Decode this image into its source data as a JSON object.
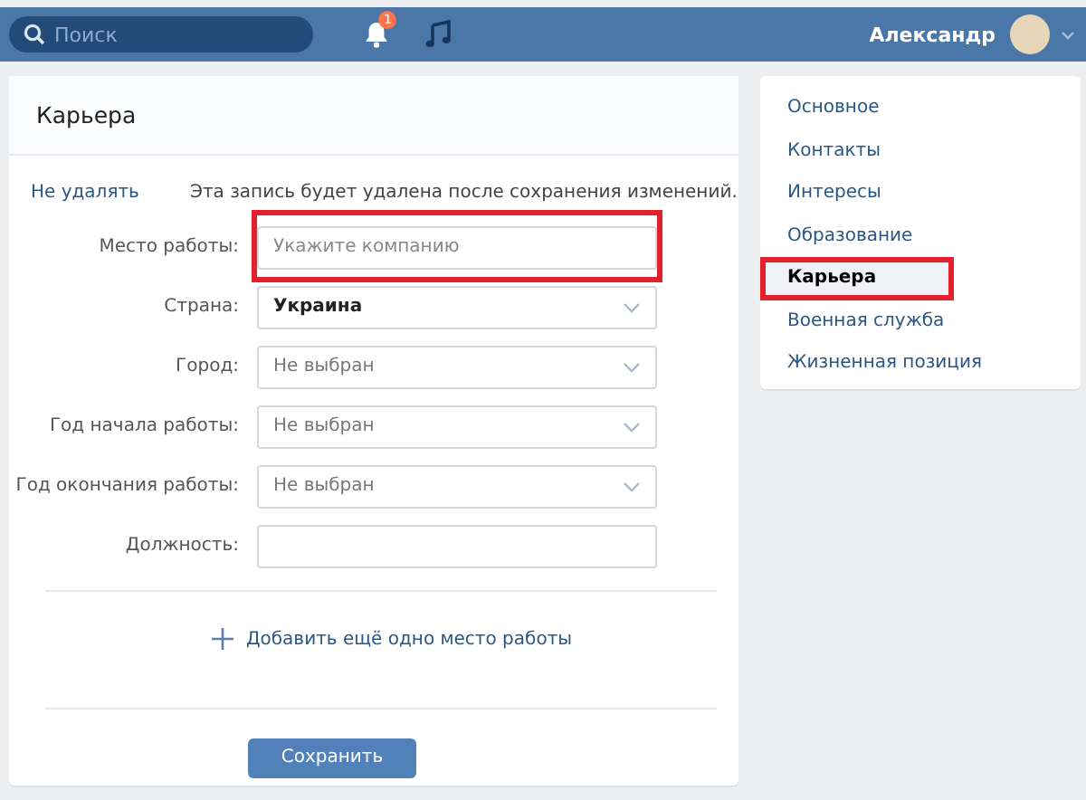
{
  "header": {
    "search": {
      "placeholder": "Поиск"
    },
    "notifications": {
      "badge": "1"
    },
    "user": {
      "name": "Александр"
    }
  },
  "career": {
    "title": "Карьера",
    "undo_link": "Не удалять",
    "notice": "Эта запись будет удалена после сохранения изменений.",
    "fields": [
      {
        "kind": "input",
        "label": "Место работы:",
        "placeholder": "Укажите компанию",
        "highlighted": true
      },
      {
        "kind": "select",
        "label": "Страна:",
        "value": "Украина",
        "chosen": true,
        "highlighted": false
      },
      {
        "kind": "select",
        "label": "Город:",
        "value": "Не выбран",
        "chosen": false,
        "highlighted": false
      },
      {
        "kind": "select",
        "label": "Год начала работы:",
        "value": "Не выбран",
        "chosen": false,
        "highlighted": false
      },
      {
        "kind": "select",
        "label": "Год окончания работы:",
        "value": "Не выбран",
        "chosen": false,
        "highlighted": false
      },
      {
        "kind": "input",
        "label": "Должность:",
        "highlighted": false
      }
    ],
    "add_link": "Добавить ещё одно место работы",
    "save_button": "Сохранить"
  },
  "sidebar": {
    "items": [
      {
        "label": "Основное",
        "selected": false,
        "highlighted": false
      },
      {
        "label": "Контакты",
        "selected": false,
        "highlighted": false
      },
      {
        "label": "Интересы",
        "selected": false,
        "highlighted": false
      },
      {
        "label": "Образование",
        "selected": false,
        "highlighted": false
      },
      {
        "label": "Карьера",
        "selected": true,
        "highlighted": true
      },
      {
        "label": "Военная служба",
        "selected": false,
        "highlighted": false
      },
      {
        "label": "Жизненная позиция",
        "selected": false,
        "highlighted": false
      }
    ]
  }
}
